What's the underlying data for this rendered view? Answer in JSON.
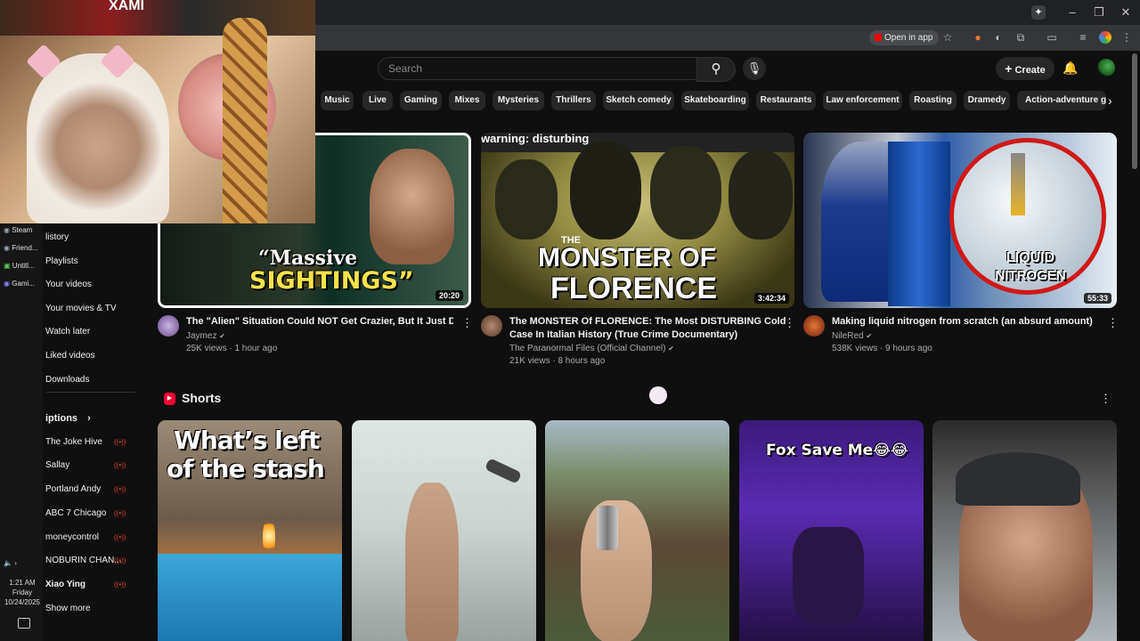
{
  "browser": {
    "open_in_app": "Open in app"
  },
  "header": {
    "search_placeholder": "Search",
    "create_label": "Create"
  },
  "chips": [
    "Music",
    "Live",
    "Gaming",
    "Mixes",
    "Mysteries",
    "Thrillers",
    "Sketch comedy",
    "Skateboarding",
    "Restaurants",
    "Law enforcement",
    "Roasting",
    "Dramedy",
    "Action-adventure gam"
  ],
  "sidebar": {
    "items": [
      "History",
      "Playlists",
      "Your videos",
      "Your movies & TV",
      "Watch later",
      "Liked videos",
      "Downloads"
    ],
    "items_visible": [
      "listory",
      "Playlists",
      "Your videos",
      "Your movies & TV",
      "Watch later",
      "Liked videos",
      "Downloads"
    ],
    "subscriptions_label": "iptions",
    "subscriptions": [
      "The Joke Hive",
      "Sallay",
      "Portland Andy",
      "ABC 7 Chicago",
      "moneycontrol",
      "NOBURIN CHAN...",
      "Xiao Ying"
    ],
    "show_more": "Show more"
  },
  "tray": {
    "apps": [
      "Steam",
      "Friend...",
      "Untitl...",
      "Gami..."
    ],
    "time": "1:21 AM",
    "day": "Friday",
    "date": "10/24/2025"
  },
  "videos": [
    {
      "thumb_text_1": "“Massive",
      "thumb_text_2": "SIGHTINGS”",
      "duration": "20:20",
      "title": "The \"Alien\" Situation Could NOT Get Crazier, But It Just Did....",
      "channel": "Jaymez",
      "meta": "25K views · 1 hour ago"
    },
    {
      "thumb_warning": "warning: disturbing",
      "thumb_text_1": "THE",
      "thumb_text_2": "MONSTER OF",
      "thumb_text_3": "FLORENCE",
      "duration": "3:42:34",
      "title_line1": "The MONSTER Of FLORENCE: The Most DISTURBING Cold",
      "title_line2": "Case In Italian History (True Crime Documentary)",
      "channel": "The Paranormal Files (Official Channel)",
      "meta": "21K views · 8 hours ago"
    },
    {
      "thumb_text_1": "LIQUID",
      "thumb_text_2": "NITROGEN",
      "duration": "55:33",
      "title": "Making liquid nitrogen from scratch (an absurd amount)",
      "channel": "NileRed",
      "meta": "538K views · 9 hours ago"
    }
  ],
  "shorts": {
    "heading": "Shorts",
    "items": [
      {
        "caption_1": "What’s left",
        "caption_2": "of the stash"
      },
      {
        "caption_1": ""
      },
      {
        "caption_1": ""
      },
      {
        "caption_1": "Fox Save Me😂😂"
      },
      {
        "caption_1": ""
      }
    ]
  },
  "webcam": {
    "poster_text": "XAMI"
  }
}
